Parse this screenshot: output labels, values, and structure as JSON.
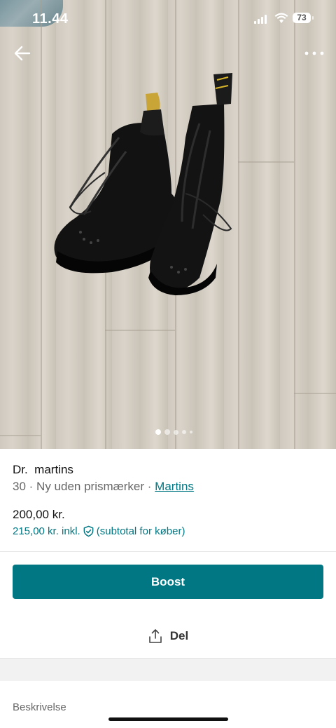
{
  "status_bar": {
    "time": "11.44",
    "battery": "73"
  },
  "photo": {
    "alt": "",
    "page_count": 5,
    "current_page": 1
  },
  "item": {
    "title": "Dr.  martins",
    "size": "30",
    "condition": "Ny uden prismærker",
    "brand": "Martins",
    "price": "200,00 kr.",
    "price_incl": "215,00 kr. inkl.",
    "price_incl_note": "(subtotal for køber)"
  },
  "actions": {
    "boost_label": "Boost",
    "share_label": "Del"
  },
  "sections": {
    "description_label": "Beskrivelse"
  },
  "colors": {
    "accent": "#007782"
  }
}
